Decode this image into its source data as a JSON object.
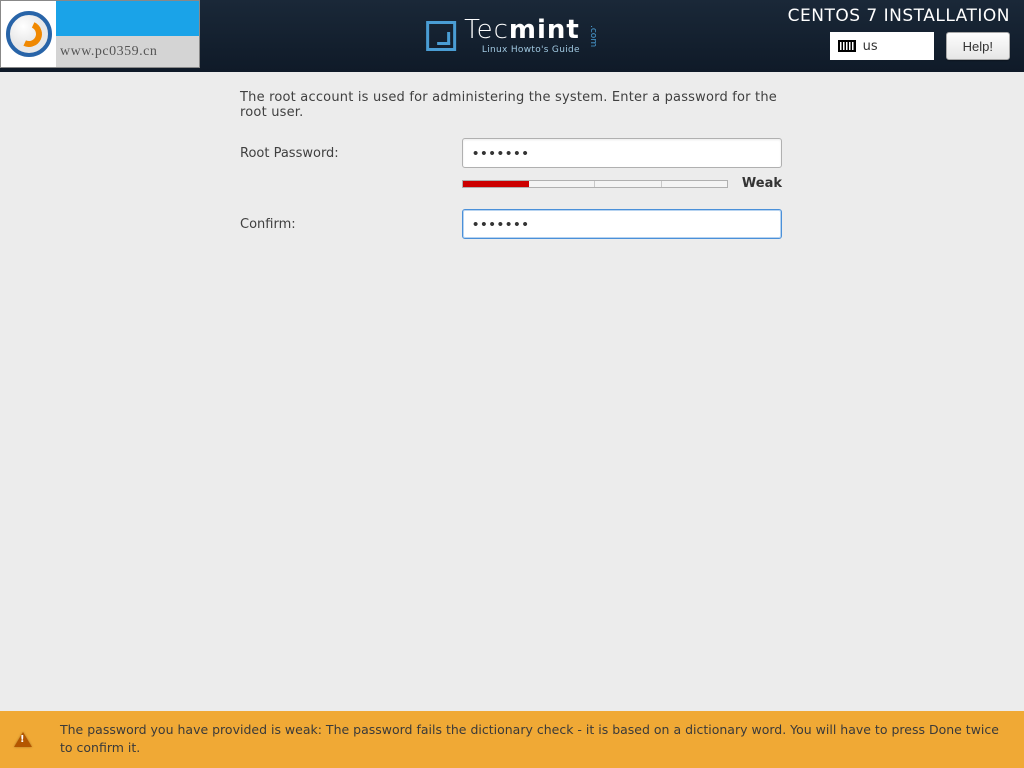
{
  "watermark": {
    "url": "www.pc0359.cn"
  },
  "header": {
    "brand_main": "Tec",
    "brand_bold": "mint",
    "brand_suffix": ".com",
    "brand_sub": "Linux Howto's Guide",
    "title": "CENTOS 7 INSTALLATION",
    "keyboard_layout": "us",
    "help_label": "Help!"
  },
  "form": {
    "instruction": "The root account is used for administering the system.  Enter a password for the root user.",
    "password_label": "Root Password:",
    "password_value": "•••••••",
    "confirm_label": "Confirm:",
    "confirm_value": "•••••••",
    "strength_label": "Weak"
  },
  "warning": {
    "text": "The password you have provided is weak: The password fails the dictionary check - it is based on a dictionary word. You will have to press Done twice to confirm it."
  }
}
